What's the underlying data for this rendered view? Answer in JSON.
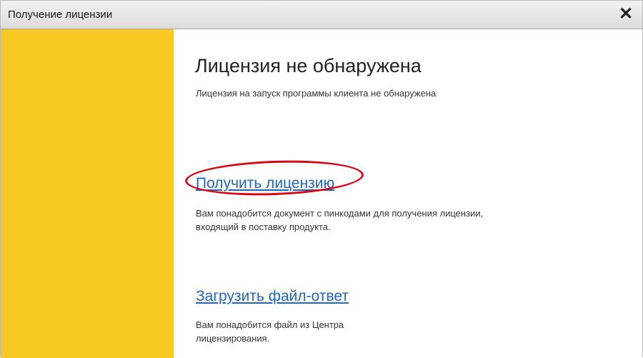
{
  "window": {
    "title": "Получение лицензии",
    "close_symbol": "✕"
  },
  "main": {
    "heading": "Лицензия не обнаружена",
    "subtext": "Лицензия на запуск программы клиента не обнаружена",
    "get_license": {
      "label": "Получить лицензию",
      "description": "Вам понадобится документ с пинкодами для получения лицензии, входящий в поставку продукта."
    },
    "load_response": {
      "label": "Загрузить файл-ответ",
      "description": "Вам понадобится файл из Центра лицензирования."
    }
  },
  "colors": {
    "side_panel": "#f8c823",
    "link": "#1f66c4",
    "highlight": "#d40a1a"
  },
  "icons": {
    "close": "close-icon"
  }
}
